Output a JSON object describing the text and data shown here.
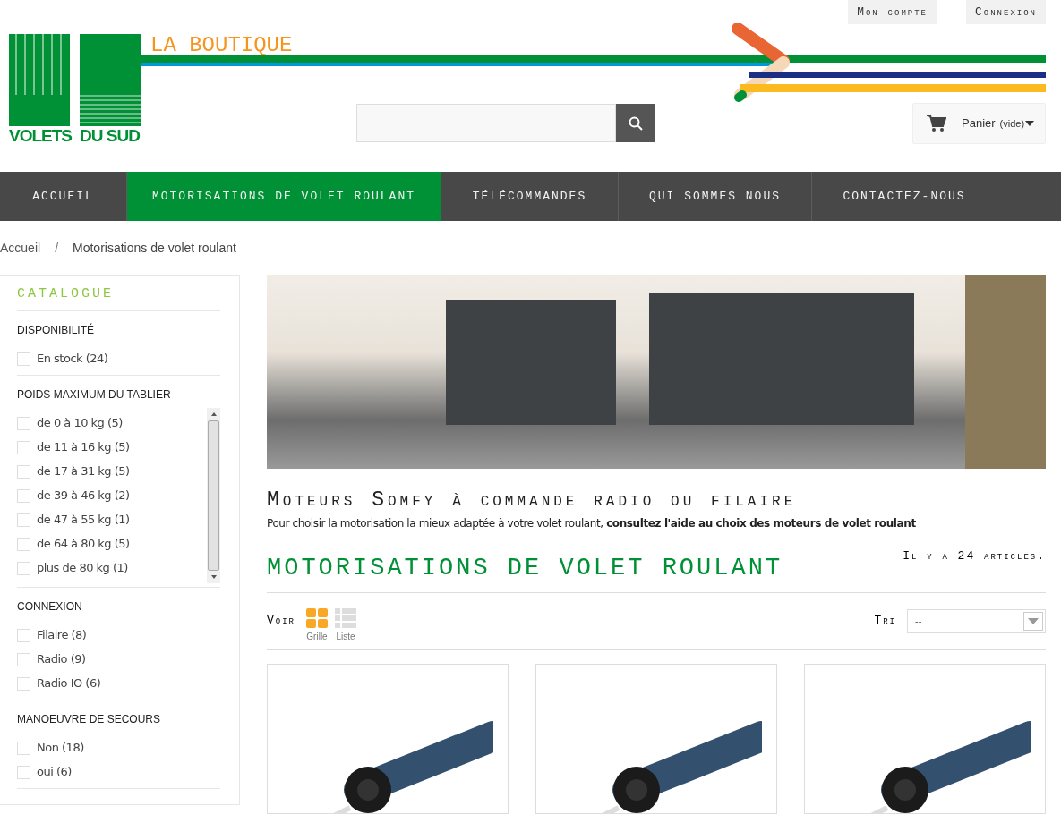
{
  "top_links": [
    "Mon compte",
    "Connexion"
  ],
  "logo": {
    "words": [
      "VOLETS",
      "DU SUD"
    ],
    "tagline": "LA BOUTIQUE"
  },
  "cart": {
    "label": "Panier",
    "state": "(vide)"
  },
  "nav": [
    {
      "label": "ACCUEIL",
      "selected": false
    },
    {
      "label": "MOTORISATIONS DE VOLET ROULANT",
      "selected": true
    },
    {
      "label": "TÉLÉCOMMANDES",
      "selected": false
    },
    {
      "label": "QUI SOMMES NOUS",
      "selected": false
    },
    {
      "label": "CONTACTEZ-NOUS",
      "selected": false
    }
  ],
  "breadcrumb": [
    "Accueil",
    "Motorisations de volet roulant"
  ],
  "breadcrumb_separator": "/",
  "sidebar": {
    "title": "CATALOGUE",
    "groups": [
      {
        "title": "DISPONIBILITÉ",
        "scroll": false,
        "options": [
          {
            "label": "En stock (24)",
            "checked": false
          }
        ]
      },
      {
        "title": "POIDS MAXIMUM DU TABLIER",
        "scroll": true,
        "options": [
          {
            "label": "de 0 à 10 kg (5)",
            "checked": false
          },
          {
            "label": "de 11 à 16 kg (5)",
            "checked": false
          },
          {
            "label": "de 17 à 31 kg (5)",
            "checked": false
          },
          {
            "label": "de 39 à 46 kg (2)",
            "checked": false
          },
          {
            "label": "de 47 à 55 kg (1)",
            "checked": false
          },
          {
            "label": "de 64 à 80 kg (5)",
            "checked": false
          },
          {
            "label": "plus de 80 kg (1)",
            "checked": false
          }
        ]
      },
      {
        "title": "CONNEXION",
        "scroll": false,
        "options": [
          {
            "label": "Filaire (8)",
            "checked": false
          },
          {
            "label": "Radio (9)",
            "checked": false
          },
          {
            "label": "Radio IO (6)",
            "checked": false
          }
        ]
      },
      {
        "title": "MANOEUVRE DE SECOURS",
        "scroll": false,
        "options": [
          {
            "label": "Non (18)",
            "checked": false
          },
          {
            "label": "oui (6)",
            "checked": false
          }
        ]
      }
    ]
  },
  "category": {
    "heading": "Moteurs Somfy à commande radio ou filaire",
    "intro": "Pour choisir la motorisation la mieux adaptée à votre volet roulant, **consultez l'aide au choix des moteurs de volet roulant**",
    "title": "MOTORISATIONS DE VOLET ROULANT",
    "count": "Il y a 24 articles."
  },
  "view": {
    "label": "Voir",
    "modes": [
      {
        "label": "Grille",
        "kind": "grid",
        "selected": true
      },
      {
        "label": "Liste",
        "kind": "list",
        "selected": false
      }
    ]
  },
  "sort": {
    "label": "Tri",
    "value": "--"
  },
  "products": [
    {
      "kind": "motor"
    },
    {
      "kind": "motor"
    },
    {
      "kind": "motor"
    }
  ]
}
